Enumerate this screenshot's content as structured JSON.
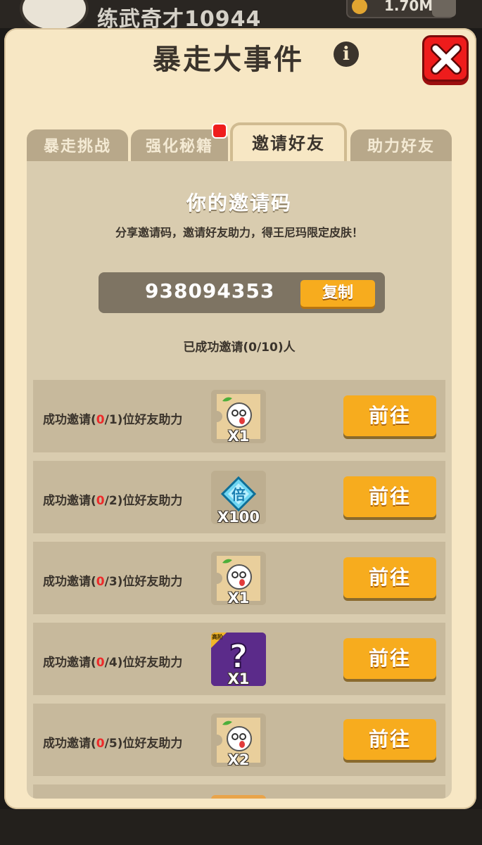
{
  "background": {
    "player_name": "练武奇才10944",
    "currency": "1.70M"
  },
  "dialog": {
    "title": "暴走大事件"
  },
  "tabs": [
    "暴走挑战",
    "强化秘籍",
    "邀请好友",
    "助力好友"
  ],
  "active_tab": "邀请好友",
  "invite": {
    "heading": "你的邀请码",
    "description": "分享邀请码，邀请好友助力，得王尼玛限定皮肤！",
    "code": "938094353",
    "copy_label": "复制",
    "count_text": "已成功邀请(0/10)人"
  },
  "tasks": [
    {
      "prefix": "成功邀请(",
      "current": "0",
      "suffix": "/1)位好友助力",
      "reward_icon": "wangnima-skin-icon",
      "quantity": "X1",
      "button": "前往"
    },
    {
      "prefix": "成功邀请(",
      "current": "0",
      "suffix": "/2)位好友助力",
      "reward_icon": "multiplier-gem-icon",
      "quantity": "X100",
      "button": "前往"
    },
    {
      "prefix": "成功邀请(",
      "current": "0",
      "suffix": "/3)位好友助力",
      "reward_icon": "wangnima-skin-icon",
      "quantity": "X1",
      "button": "前往"
    },
    {
      "prefix": "成功邀请(",
      "current": "0",
      "suffix": "/4)位好友助力",
      "reward_icon": "mystery-box-icon",
      "reward_tag": "高阶",
      "quantity": "X1",
      "button": "前往"
    },
    {
      "prefix": "成功邀请(",
      "current": "0",
      "suffix": "/5)位好友助力",
      "reward_icon": "wangnima-skin-icon",
      "quantity": "X2",
      "button": "前往"
    }
  ],
  "colors": {
    "panel": "#f7e7c4",
    "button": "#f7ac1e",
    "close": "#ee1c1c",
    "progress_red": "#ee2a2a"
  }
}
